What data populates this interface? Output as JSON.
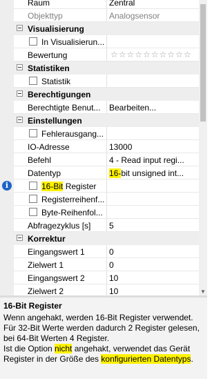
{
  "grid": {
    "rows": [
      {
        "kind": "prop",
        "name": "Raum",
        "value": "Zentral"
      },
      {
        "kind": "prop",
        "name": "Objekttyp",
        "value": "Analogsensor",
        "gray": true
      },
      {
        "kind": "cat",
        "name": "Visualisierung"
      },
      {
        "kind": "check",
        "name": "In Visualisierun...",
        "value": ""
      },
      {
        "kind": "prop",
        "name": "Bewertung",
        "value": "",
        "stars": "☆☆☆☆☆☆☆☆☆☆"
      },
      {
        "kind": "cat",
        "name": "Statistiken"
      },
      {
        "kind": "check",
        "name": "Statistik",
        "value": ""
      },
      {
        "kind": "cat",
        "name": "Berechtigungen"
      },
      {
        "kind": "prop",
        "name": "Berechtigte Benut...",
        "value": "Bearbeiten..."
      },
      {
        "kind": "cat",
        "name": "Einstellungen"
      },
      {
        "kind": "check",
        "name": "Fehlerausgang...",
        "value": ""
      },
      {
        "kind": "prop",
        "name": "IO-Adresse",
        "value": "13000"
      },
      {
        "kind": "prop",
        "name": "Befehl",
        "value": "4 - Read input regi..."
      },
      {
        "kind": "prop",
        "name": "Datentyp",
        "value_hl": "16-",
        "value_rest": "bit unsigned int..."
      },
      {
        "kind": "check",
        "name_hl": "16-Bit",
        "name_rest": " Register",
        "value": "",
        "selected": true,
        "info": true
      },
      {
        "kind": "check",
        "name": "Registerreihenf...",
        "value": ""
      },
      {
        "kind": "check",
        "name": "Byte-Reihenfol...",
        "value": ""
      },
      {
        "kind": "prop",
        "name": "Abfragezyklus [s]",
        "value": "5"
      },
      {
        "kind": "cat",
        "name": "Korrektur"
      },
      {
        "kind": "prop",
        "name": "Eingangswert 1",
        "value": "0"
      },
      {
        "kind": "prop",
        "name": "Zielwert 1",
        "value": "0"
      },
      {
        "kind": "prop",
        "name": "Eingangswert 2",
        "value": "10"
      },
      {
        "kind": "prop",
        "name": "Zielwert 2",
        "value": "10"
      }
    ]
  },
  "description": {
    "title": "16-Bit Register",
    "line1": "Wenn angehakt, werden 16-Bit Register verwendet. Für 32-Bit Werte werden dadurch 2 Register gelesen, bei 64-Bit Werten 4 Register.",
    "line2_a": "Ist die Option ",
    "line2_hl": "nicht",
    "line2_b": " angehakt, verwendet das Gerät Register in der Größe des ",
    "line2_hl2": "konfigurierten Datentyps",
    "line2_c": "."
  },
  "icons": {
    "info": "i",
    "category_toggle": "minus-box",
    "rating": "star-outline"
  },
  "colors": {
    "highlight": "#fff200",
    "info": "#1e64c8",
    "category_bg": "#eeeeee"
  }
}
